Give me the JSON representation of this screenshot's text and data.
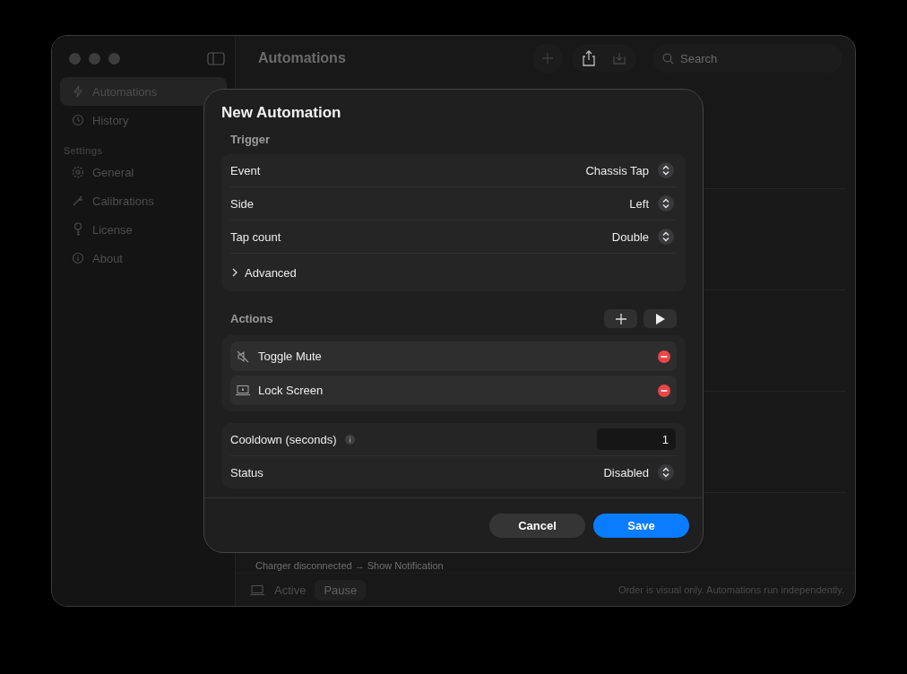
{
  "window": {
    "title": "Automations"
  },
  "sidebar": {
    "items": [
      {
        "label": "Automations",
        "selected": true
      },
      {
        "label": "History",
        "selected": false
      }
    ],
    "section": "Settings",
    "settings_items": [
      {
        "label": "General",
        "selected": false
      },
      {
        "label": "Calibrations",
        "selected": false
      },
      {
        "label": "License",
        "selected": false
      },
      {
        "label": "About",
        "selected": false
      }
    ]
  },
  "toolbar": {
    "search": {
      "placeholder": "Search"
    }
  },
  "background": {
    "automation_summary": "Charger disconnected → Show Notification",
    "status": "Active",
    "pause_button": "Pause",
    "footer_note": "Order is visual only. Automations run independently."
  },
  "dialog": {
    "title": "New Automation",
    "trigger": {
      "heading": "Trigger",
      "rows": [
        {
          "label": "Event",
          "value": "Chassis Tap"
        },
        {
          "label": "Side",
          "value": "Left"
        },
        {
          "label": "Tap count",
          "value": "Double"
        }
      ],
      "advanced": {
        "label": "Advanced",
        "expanded": false
      }
    },
    "actions": {
      "heading": "Actions",
      "items": [
        {
          "label": "Toggle Mute"
        },
        {
          "label": "Lock Screen"
        }
      ]
    },
    "cooldown": {
      "label": "Cooldown (seconds)",
      "value": "1"
    },
    "status": {
      "label": "Status",
      "value": "Disabled"
    },
    "buttons": {
      "cancel": "Cancel",
      "save": "Save"
    }
  }
}
